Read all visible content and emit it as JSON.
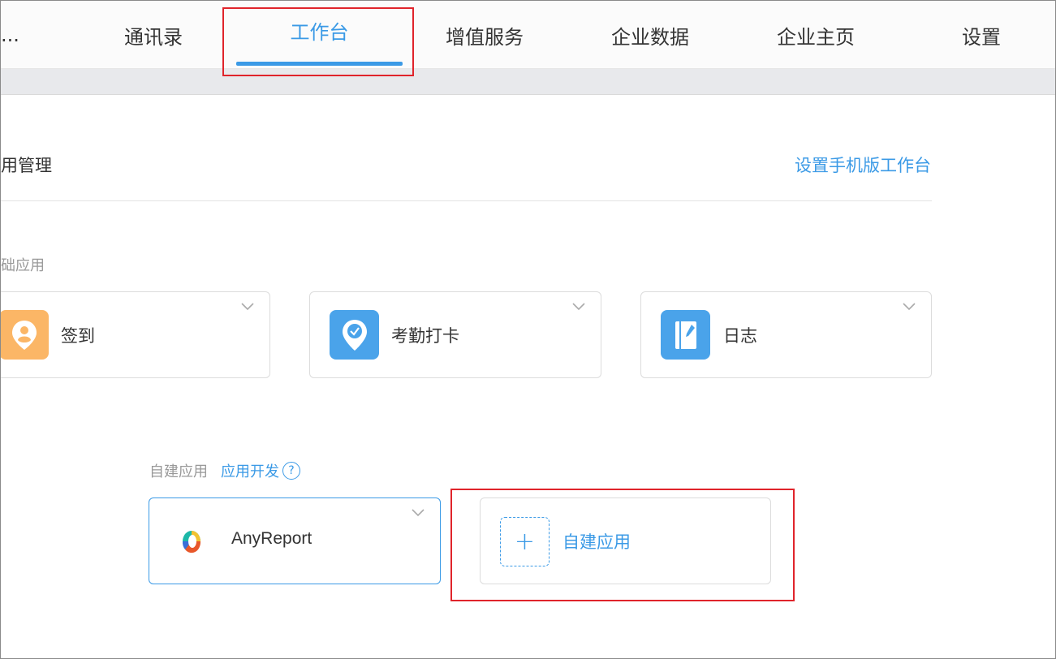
{
  "nav": {
    "overflow": "...",
    "items": [
      "通讯录",
      "工作台",
      "增值服务",
      "企业数据",
      "企业主页",
      "设置"
    ],
    "active": "工作台"
  },
  "header": {
    "title": "用管理",
    "mobile_link": "设置手机版工作台"
  },
  "basic_apps": {
    "label": "础应用",
    "apps": [
      {
        "name": "签到",
        "icon": "person-pin-icon",
        "color": "#fbb666"
      },
      {
        "name": "考勤打卡",
        "icon": "location-check-icon",
        "color": "#4aa3ea"
      },
      {
        "name": "日志",
        "icon": "notebook-pen-icon",
        "color": "#4aa3ea"
      }
    ]
  },
  "custom_apps": {
    "label": "自建应用",
    "dev_link": "应用开发",
    "help": "?",
    "apps": [
      {
        "name": "AnyReport",
        "icon": "anyreport-logo-icon"
      }
    ],
    "add": {
      "symbol": "+",
      "label": "自建应用"
    }
  },
  "colors": {
    "accent": "#3b9ae6",
    "highlight": "#e0242b"
  }
}
